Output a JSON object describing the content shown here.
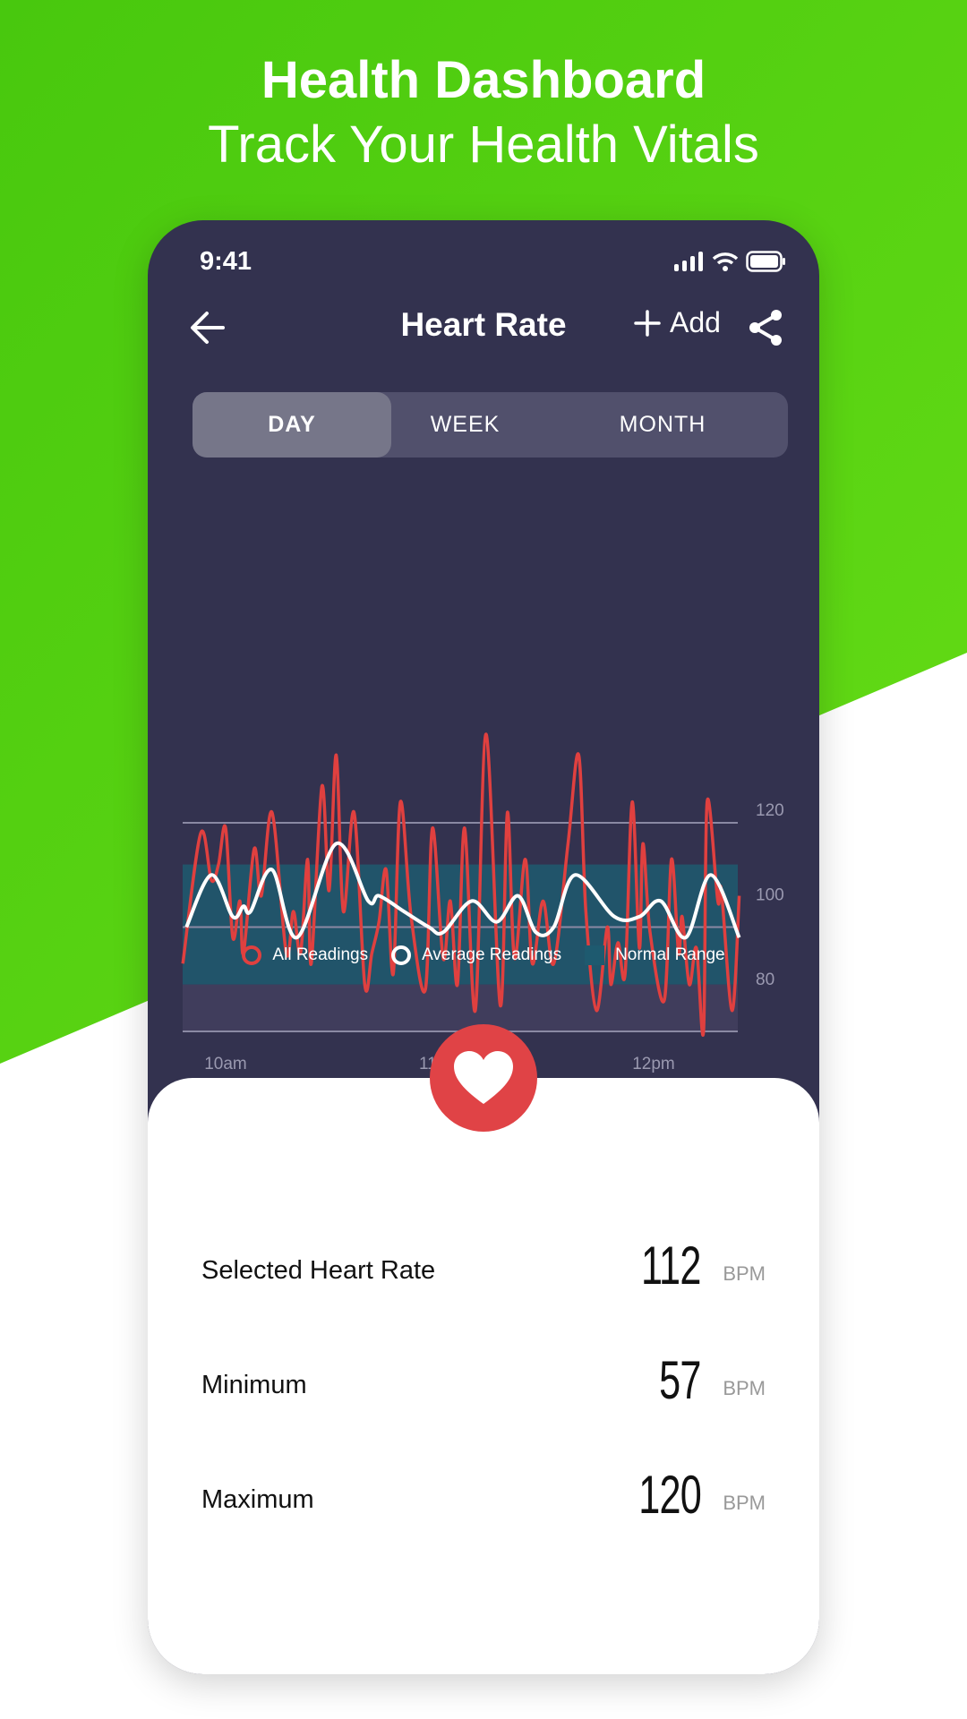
{
  "header": {
    "title": "Health Dashboard",
    "subtitle": "Track Your Health Vitals"
  },
  "colors": {
    "green": "#52cf10",
    "phone_bg": "#33324f",
    "all_readings": "#e0403f",
    "average": "#ffffff",
    "normal_range": "#1e5a6f",
    "heart": "#e04346"
  },
  "status_bar": {
    "time": "9:41",
    "icons": [
      "cellular-signal-icon",
      "wifi-icon",
      "battery-icon"
    ]
  },
  "nav": {
    "title": "Heart Rate",
    "add_label": "Add",
    "icons": [
      "back-arrow-icon",
      "plus-icon",
      "share-icon"
    ]
  },
  "tabs": [
    {
      "label": "DAY",
      "active": true
    },
    {
      "label": "WEEK",
      "active": false
    },
    {
      "label": "MONTH",
      "active": false
    }
  ],
  "chart_data": {
    "type": "line",
    "y_ticks": [
      {
        "value": 120,
        "label": "120"
      },
      {
        "value": 100,
        "label": "100"
      },
      {
        "value": 80,
        "label": "80"
      }
    ],
    "x_ticks": [
      {
        "time": "10:00",
        "label": "10am"
      },
      {
        "time": "11:00",
        "label": "11am"
      },
      {
        "time": "12:00",
        "label": "12pm"
      }
    ],
    "ylim": [
      80,
      137
    ],
    "xlim": [
      "09:48",
      "12:24"
    ],
    "normal_range": [
      89,
      112
    ],
    "grid": true,
    "legend_position": "bottom",
    "series": [
      {
        "name": "All Readings",
        "color": "#e0403f",
        "points": [
          [
            "09:48",
            93
          ],
          [
            "09:53",
            118
          ],
          [
            "09:56",
            109
          ],
          [
            "09:58",
            112
          ],
          [
            "10:00",
            119
          ],
          [
            "10:02",
            98
          ],
          [
            "10:04",
            105
          ],
          [
            "10:05",
            95
          ],
          [
            "10:08",
            115
          ],
          [
            "10:10",
            106
          ],
          [
            "10:13",
            122
          ],
          [
            "10:17",
            95
          ],
          [
            "10:19",
            103
          ],
          [
            "10:21",
            95
          ],
          [
            "10:23",
            113
          ],
          [
            "10:24",
            93
          ],
          [
            "10:27",
            127
          ],
          [
            "10:29",
            107
          ],
          [
            "10:31",
            133
          ],
          [
            "10:33",
            103
          ],
          [
            "10:36",
            122
          ],
          [
            "10:39",
            89
          ],
          [
            "10:41",
            95
          ],
          [
            "10:43",
            101
          ],
          [
            "10:45",
            111
          ],
          [
            "10:47",
            91
          ],
          [
            "10:49",
            124
          ],
          [
            "10:52",
            102
          ],
          [
            "10:56",
            88
          ],
          [
            "10:58",
            119
          ],
          [
            "11:01",
            94
          ],
          [
            "11:03",
            105
          ],
          [
            "11:05",
            89
          ],
          [
            "11:07",
            119
          ],
          [
            "11:10",
            84
          ],
          [
            "11:13",
            137
          ],
          [
            "11:17",
            85
          ],
          [
            "11:19",
            122
          ],
          [
            "11:21",
            94
          ],
          [
            "11:24",
            113
          ],
          [
            "11:26",
            93
          ],
          [
            "11:29",
            105
          ],
          [
            "11:32",
            93
          ],
          [
            "11:36",
            116
          ],
          [
            "11:39",
            133
          ],
          [
            "11:41",
            103
          ],
          [
            "11:44",
            84
          ],
          [
            "11:47",
            100
          ],
          [
            "11:48",
            89
          ],
          [
            "11:50",
            97
          ],
          [
            "11:52",
            91
          ],
          [
            "11:54",
            124
          ],
          [
            "11:56",
            96
          ],
          [
            "11:57",
            116
          ],
          [
            "11:59",
            99
          ],
          [
            "12:03",
            86
          ],
          [
            "12:05",
            113
          ],
          [
            "12:07",
            95
          ],
          [
            "12:08",
            102
          ],
          [
            "12:10",
            89
          ],
          [
            "12:12",
            96
          ],
          [
            "12:14",
            80
          ],
          [
            "12:15",
            124
          ],
          [
            "12:18",
            105
          ],
          [
            "12:19",
            107
          ],
          [
            "12:22",
            84
          ],
          [
            "12:24",
            106
          ]
        ]
      },
      {
        "name": "Average Readings",
        "color": "#ffffff",
        "points": [
          [
            "09:49",
            100
          ],
          [
            "09:56",
            110
          ],
          [
            "10:02",
            102
          ],
          [
            "10:05",
            104
          ],
          [
            "10:07",
            103
          ],
          [
            "10:13",
            111
          ],
          [
            "10:20",
            98
          ],
          [
            "10:31",
            116
          ],
          [
            "10:40",
            105
          ],
          [
            "10:43",
            106
          ],
          [
            "10:50",
            103
          ],
          [
            "10:57",
            100
          ],
          [
            "11:01",
            99
          ],
          [
            "11:09",
            105
          ],
          [
            "11:16",
            101
          ],
          [
            "11:22",
            106
          ],
          [
            "11:27",
            99
          ],
          [
            "11:32",
            100
          ],
          [
            "11:38",
            110
          ],
          [
            "11:49",
            102
          ],
          [
            "11:56",
            102
          ],
          [
            "12:02",
            105
          ],
          [
            "12:09",
            98
          ],
          [
            "12:16",
            110
          ],
          [
            "12:24",
            98
          ]
        ]
      }
    ]
  },
  "legend": [
    {
      "label": "All Readings"
    },
    {
      "label": "Average Readings"
    },
    {
      "label": "Normal Range"
    }
  ],
  "stats": [
    {
      "label": "Selected Heart Rate",
      "value": "112",
      "unit": "BPM"
    },
    {
      "label": "Minimum",
      "value": "57",
      "unit": "BPM"
    },
    {
      "label": "Maximum",
      "value": "120",
      "unit": "BPM"
    }
  ]
}
